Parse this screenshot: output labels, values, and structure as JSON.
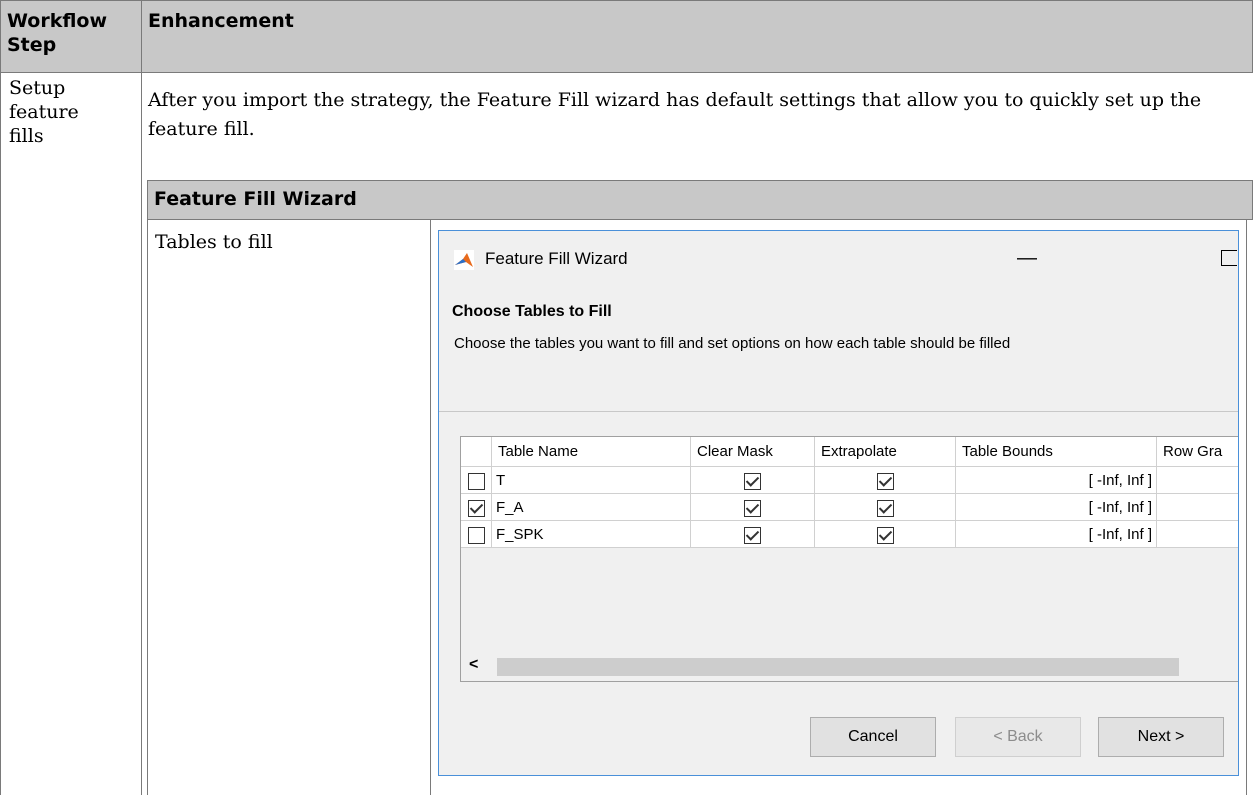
{
  "outer_table": {
    "col1_header": "Workflow Step",
    "col2_header": "Enhancement",
    "row1_step": "Setup feature fills",
    "row1_text": "After you import the strategy, the Feature Fill wizard has default settings that allow you to quickly set up the feature fill."
  },
  "inner_table": {
    "header": "Feature Fill Wizard",
    "row1_label": "Tables to fill"
  },
  "dialog": {
    "title": "Feature Fill Wizard",
    "minimize_glyph": "—",
    "heading": "Choose Tables to Fill",
    "subtitle": "Choose the tables you want to fill and set options on how each table should be filled",
    "columns": [
      "",
      "Table Name",
      "Clear Mask",
      "Extrapolate",
      "Table Bounds",
      "Row Gra"
    ],
    "rows": [
      {
        "selected": false,
        "name": "T",
        "clear_mask": true,
        "extrapolate": true,
        "bounds": "[ -Inf, Inf ]"
      },
      {
        "selected": true,
        "name": "F_A",
        "clear_mask": true,
        "extrapolate": true,
        "bounds": "[ -Inf, Inf ]"
      },
      {
        "selected": false,
        "name": "F_SPK",
        "clear_mask": true,
        "extrapolate": true,
        "bounds": "[ -Inf, Inf ]"
      }
    ],
    "scroll_left_glyph": "<",
    "buttons": {
      "cancel": "Cancel",
      "back": "< Back",
      "next": "Next >"
    }
  }
}
